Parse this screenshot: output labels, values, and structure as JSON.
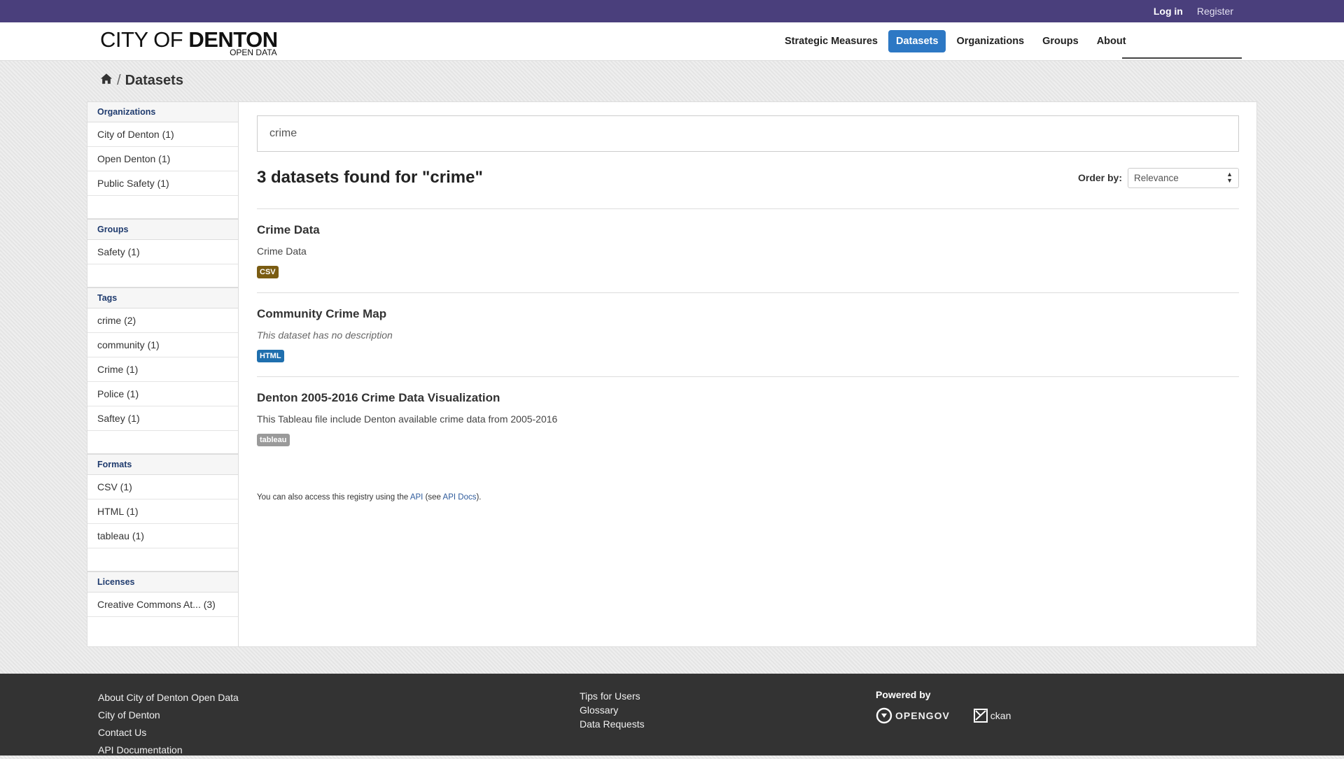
{
  "account": {
    "login": "Log in",
    "register": "Register"
  },
  "brand": {
    "line1_light": "CITY OF",
    "line1_bold": "DENTON",
    "line2": "OPEN DATA"
  },
  "nav": {
    "items": [
      {
        "label": "Strategic Measures",
        "active": false
      },
      {
        "label": "Datasets",
        "active": true
      },
      {
        "label": "Organizations",
        "active": false
      },
      {
        "label": "Groups",
        "active": false
      },
      {
        "label": "About",
        "active": false
      }
    ],
    "search_value": ""
  },
  "breadcrumb": {
    "current": "Datasets",
    "separator": "/"
  },
  "facets": {
    "organizations": {
      "title": "Organizations",
      "items": [
        "City of Denton (1)",
        "Open Denton (1)",
        "Public Safety (1)"
      ]
    },
    "groups": {
      "title": "Groups",
      "items": [
        "Safety (1)"
      ]
    },
    "tags": {
      "title": "Tags",
      "items": [
        "crime (2)",
        "community (1)",
        "Crime (1)",
        "Police (1)",
        "Saftey (1)"
      ]
    },
    "formats": {
      "title": "Formats",
      "items": [
        "CSV (1)",
        "HTML (1)",
        "tableau (1)"
      ]
    },
    "licenses": {
      "title": "Licenses",
      "items": [
        "Creative Commons At... (3)"
      ]
    }
  },
  "search": {
    "query": "crime"
  },
  "results": {
    "heading": "3 datasets found for \"crime\"",
    "order_label": "Order by:",
    "order_value": "Relevance",
    "datasets": [
      {
        "title": "Crime Data",
        "description": "Crime Data",
        "empty": false,
        "format": "CSV",
        "format_color": "#7a5c12"
      },
      {
        "title": "Community Crime Map",
        "description": "This dataset has no description",
        "empty": true,
        "format": "HTML",
        "format_color": "#1f6fae"
      },
      {
        "title": "Denton 2005-2016 Crime Data Visualization",
        "description": "This Tableau file include Denton available crime data from 2005-2016",
        "empty": false,
        "format": "tableau",
        "format_color": "#9a9a9a"
      }
    ],
    "api_note": {
      "before": "You can also access this registry using the ",
      "api": "API",
      "middle": " (see ",
      "docs": "API Docs",
      "after": ")."
    }
  },
  "footer": {
    "col1": [
      "About City of Denton Open Data",
      "City of Denton",
      "Contact Us",
      "API Documentation"
    ],
    "col2": [
      "Tips for Users",
      "Glossary",
      "Data Requests"
    ],
    "powered_by": "Powered by",
    "logo1": "OPENGOV",
    "logo2": "ckan"
  },
  "colors": {
    "topbar": "#4a3f7c",
    "active_nav": "#2d78c4",
    "footer": "#333333"
  }
}
